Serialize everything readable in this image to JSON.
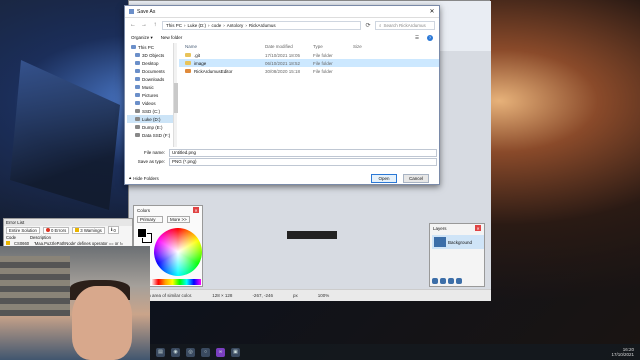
{
  "paint": {
    "status_hint": "... are an area of similar color.",
    "status_size": "128 × 128",
    "status_pos": "-267, -246",
    "status_unit": "px",
    "status_zoom": "100%"
  },
  "dialog": {
    "title": "Save As",
    "breadcrumb": [
      "This PC",
      "Luke (D:)",
      "code",
      "Antolory",
      "RickArdumus"
    ],
    "search_placeholder": "Search RickArdumus",
    "cmd_organize": "Organize ▾",
    "cmd_new_folder": "New folder",
    "nav": [
      {
        "label": "This PC"
      },
      {
        "label": "3D Objects"
      },
      {
        "label": "Desktop"
      },
      {
        "label": "Documents"
      },
      {
        "label": "Downloads"
      },
      {
        "label": "Music"
      },
      {
        "label": "Pictures"
      },
      {
        "label": "Videos"
      },
      {
        "label": "SSD (C:)"
      },
      {
        "label": "Luke (D:)"
      },
      {
        "label": "Dump (E:)"
      },
      {
        "label": "Data SSD (F:)"
      }
    ],
    "headers": {
      "name": "Name",
      "date": "Date modified",
      "type": "Type",
      "size": "Size"
    },
    "files": [
      {
        "name": ".git",
        "date": "17/10/2021 18:05",
        "type": "File folder"
      },
      {
        "name": "image",
        "date": "06/10/2021 18:52",
        "type": "File folder"
      },
      {
        "name": "RickArdumusEditor",
        "date": "30/08/2020 15:18",
        "type": "File folder"
      }
    ],
    "filename_label": "File name:",
    "filename_value": "Untitled.png",
    "savetype_label": "Save as type:",
    "savetype_value": "PNG (*.png)",
    "hide_folders": "Hide Folders",
    "open_button": "Open",
    "cancel_button": "Cancel"
  },
  "colors_panel": {
    "title": "Colors",
    "primary_select": "Primary",
    "more_button": "More >>"
  },
  "layers_panel": {
    "title": "Layers",
    "layer_name": "Background"
  },
  "error_list": {
    "title": "Error List",
    "scope": "Entire Solution",
    "errors": "0 Errors",
    "warnings": "3 Warnings",
    "messages": "0",
    "col_code": "Code",
    "col_desc": "Description",
    "row_code": "CS0660",
    "row_desc": "'Maa.PuzzlePathNode' defines operator == or !="
  },
  "taskbar": {
    "time": "16:20",
    "date": "17/10/2021"
  }
}
